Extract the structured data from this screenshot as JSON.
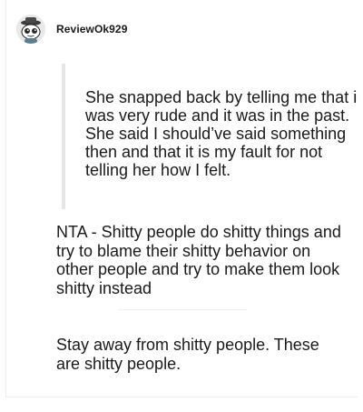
{
  "comment": {
    "username": "ReviewOk929",
    "avatar_icon": "reddit-snoo-avatar-icon",
    "quote": "She snapped back by telling me that i was very rude and it was in the past. She said I should’ve said something then and that it is my fault for not telling her how I felt.",
    "paragraphs": [
      "NTA - Shitty people do shitty things and try to blame their shitty behavior on other people and try to make them look shitty instead",
      "Stay away from shitty people. These are shitty people."
    ]
  },
  "colors": {
    "text": "#1a1a1b",
    "quote_bar": "#e6e6e6",
    "background": "#ffffff"
  }
}
